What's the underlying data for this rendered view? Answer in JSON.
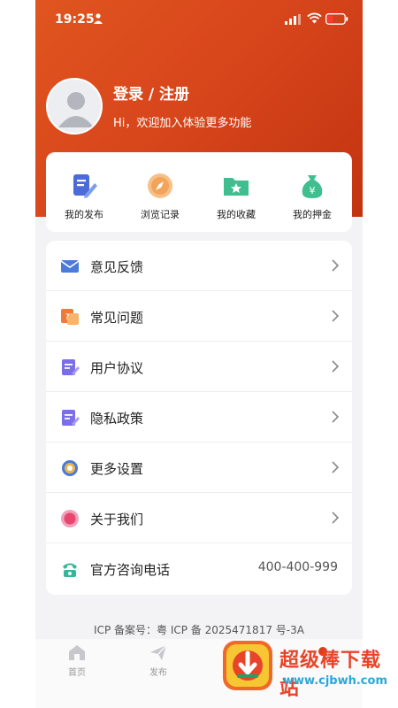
{
  "status_bar": {
    "time": "19:25"
  },
  "profile": {
    "title": "登录 / 注册",
    "subtitle": "Hi，欢迎加入体验更多功能"
  },
  "quick_actions": [
    {
      "label": "我的发布",
      "icon": "edit-document-icon",
      "color": "#4a6bd8"
    },
    {
      "label": "浏览记录",
      "icon": "compass-icon",
      "color": "#f2a55a"
    },
    {
      "label": "我的收藏",
      "icon": "star-folder-icon",
      "color": "#3fbf8f"
    },
    {
      "label": "我的押金",
      "icon": "money-bag-icon",
      "color": "#3fbf8f"
    }
  ],
  "menu": [
    {
      "label": "意见反馈",
      "icon": "mail-icon"
    },
    {
      "label": "常见问题",
      "icon": "question-card-icon"
    },
    {
      "label": "用户协议",
      "icon": "document-pen-icon"
    },
    {
      "label": "隐私政策",
      "icon": "document-pen-icon"
    },
    {
      "label": "更多设置",
      "icon": "gear-icon"
    },
    {
      "label": "关于我们",
      "icon": "info-circle-icon"
    },
    {
      "label": "官方咨询电话",
      "icon": "phone-icon",
      "value": "400-400-999"
    }
  ],
  "icp": "ICP 备案号：粤 ICP 备 2025471817 号-3A",
  "tab_bar": [
    {
      "label": "首页",
      "icon": "home-icon"
    },
    {
      "label": "发布",
      "icon": "send-icon"
    }
  ],
  "watermark": {
    "title": "超级棒下载站",
    "url": "www.cjbwh.com"
  },
  "colors": {
    "accent": "#d8461c",
    "background": "#f3f3f5",
    "watermark_red": "#e8442a",
    "watermark_blue": "#2aa7d8"
  }
}
